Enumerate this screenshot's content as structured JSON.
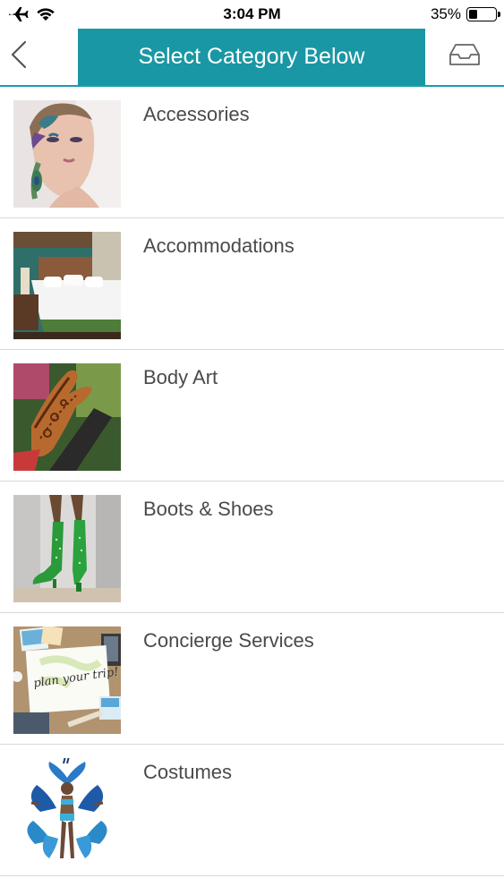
{
  "status": {
    "time": "3:04 PM",
    "battery_text": "35%",
    "battery_level": 0.35,
    "airplane_icon": "airplane-icon",
    "wifi_icon": "wifi-icon"
  },
  "header": {
    "title": "Select Category Below",
    "back_icon": "chevron-left-icon",
    "inbox_icon": "inbox-icon",
    "accent_color": "#1a97a4"
  },
  "categories": [
    {
      "label": "Accessories",
      "image": "face-paint-feathers-photo"
    },
    {
      "label": "Accommodations",
      "image": "hotel-room-photo"
    },
    {
      "label": "Body Art",
      "image": "henna-hand-photo"
    },
    {
      "label": "Boots & Shoes",
      "image": "green-boots-photo"
    },
    {
      "label": "Concierge Services",
      "image": "plan-your-trip-photo",
      "image_text": "plan your trip!"
    },
    {
      "label": "Costumes",
      "image": "carnival-costume-photo"
    }
  ]
}
